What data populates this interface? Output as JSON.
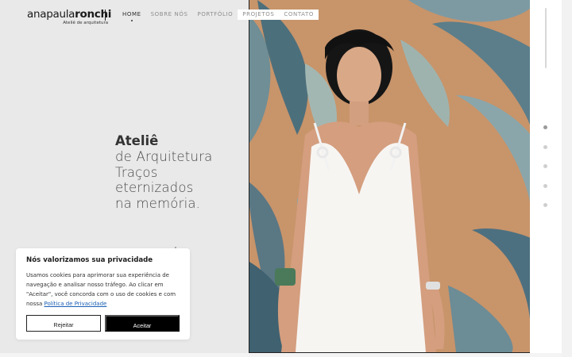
{
  "brand": {
    "name_regular": "anapaula",
    "name_bold": "ronchi",
    "tagline": "Ateliê de arquitetura"
  },
  "nav": {
    "items": [
      {
        "label": "HOME"
      },
      {
        "label": "SOBRE NÓS"
      },
      {
        "label": "PORTFÓLIO"
      },
      {
        "label": "PROJETOS"
      },
      {
        "label": "CONTATO"
      }
    ]
  },
  "hero": {
    "title": "Ateliê",
    "lines": [
      "de Arquitetura",
      "Traços",
      "eternizados",
      "na memória."
    ]
  },
  "cookie": {
    "title": "Nós valorizamos sua privacidade",
    "body": "Usamos cookies para aprimorar sua experiência de navegação e analisar nosso tráfego. Ao clicar em \"Aceitar\", você concorda com o uso de cookies e com nossa ",
    "link": "Política de Privacidade",
    "reject_label": "Rejeitar",
    "accept_label": "Aceitar"
  },
  "section_dots": {
    "count": 5,
    "active_index": 0
  },
  "colors": {
    "accent_dark": "#000000",
    "link": "#1a5fb4",
    "background": "#e9e9e9"
  }
}
